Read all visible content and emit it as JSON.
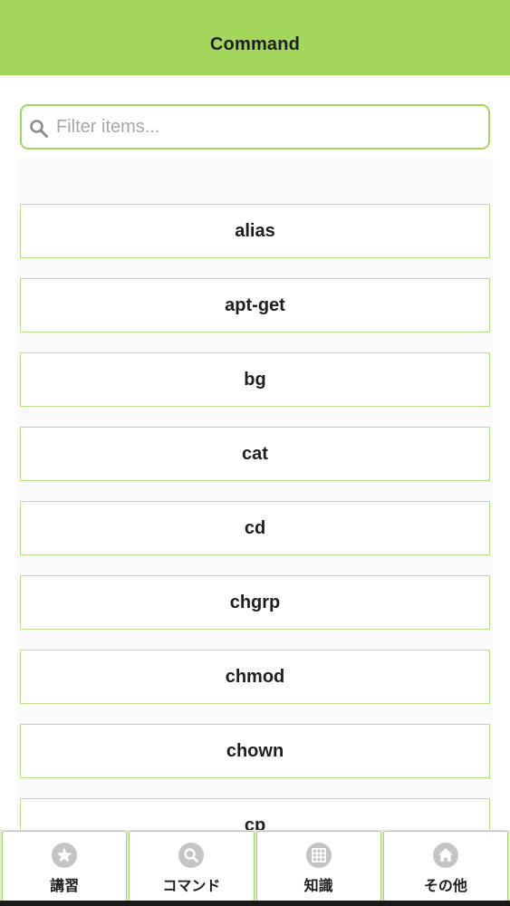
{
  "header": {
    "title": "Command"
  },
  "search": {
    "placeholder": "Filter items...",
    "value": "",
    "icon": "search-icon"
  },
  "list": {
    "items": [
      {
        "label": "alias"
      },
      {
        "label": "apt-get"
      },
      {
        "label": "bg"
      },
      {
        "label": "cat"
      },
      {
        "label": "cd"
      },
      {
        "label": "chgrp"
      },
      {
        "label": "chmod"
      },
      {
        "label": "chown"
      },
      {
        "label": "cp"
      }
    ]
  },
  "tabs": [
    {
      "label": "講習",
      "icon": "star-icon"
    },
    {
      "label": "コマンド",
      "icon": "search-icon"
    },
    {
      "label": "知識",
      "icon": "grid-icon"
    },
    {
      "label": "その他",
      "icon": "home-icon"
    }
  ],
  "colors": {
    "accent": "#a3d75c",
    "item_border": "#b7df88",
    "icon_gray": "#c4c4c4"
  }
}
